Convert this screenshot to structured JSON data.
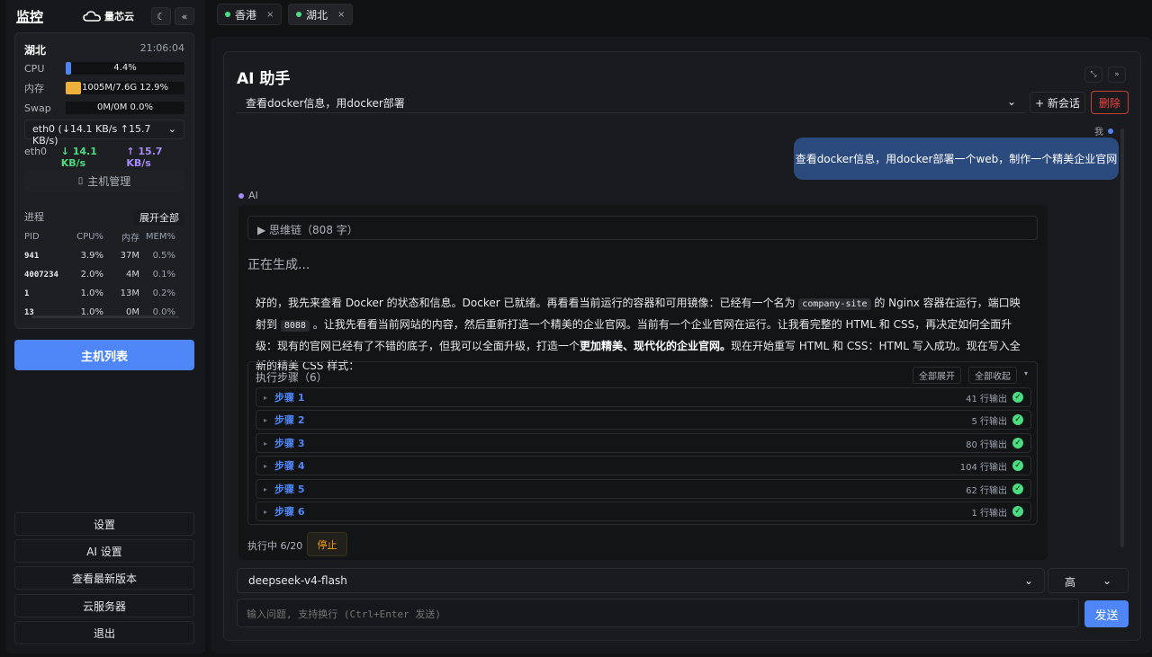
{
  "sidebar": {
    "title": "监控",
    "logo_text": "量芯云",
    "theme_icon": "moon-icon",
    "collapse_label": "«",
    "host": {
      "name": "湖北",
      "time": "21:06:04",
      "cpu": {
        "label": "CPU",
        "text": "4.4%",
        "percent": 4.4,
        "color": "#4f86f7"
      },
      "mem": {
        "label": "内存",
        "text": "1005M/7.6G 12.9%",
        "percent": 12.9,
        "color": "#f0b13b"
      },
      "swap": {
        "label": "Swap",
        "text": "0M/0M 0.0%",
        "percent": 0
      },
      "net_select": "eth0 (↓14.1 KB/s ↑15.7 KB/s)",
      "net_iface": "eth0",
      "net_down": "↓ 14.1 KB/s",
      "net_up": "↑ 15.7 KB/s",
      "host_mgmt": "主机管理",
      "process_label": "进程",
      "expand_all": "展开全部",
      "proc_headers": [
        "PID",
        "CPU%",
        "内存",
        "MEM%"
      ],
      "processes": [
        {
          "pid": "941",
          "cpu": "3.9%",
          "mem": "37M",
          "memp": "0.5%"
        },
        {
          "pid": "4007234",
          "cpu": "2.0%",
          "mem": "4M",
          "memp": "0.1%"
        },
        {
          "pid": "1",
          "cpu": "1.0%",
          "mem": "13M",
          "memp": "0.2%"
        },
        {
          "pid": "13",
          "cpu": "1.0%",
          "mem": "0M",
          "memp": "0.0%"
        }
      ]
    },
    "host_list": "主机列表",
    "bottom": [
      "设置",
      "AI 设置",
      "查看最新版本",
      "云服务器",
      "退出"
    ]
  },
  "tabs": [
    {
      "label": "香港",
      "close": "×"
    },
    {
      "label": "湖北",
      "close": "×"
    }
  ],
  "main": {
    "title": "AI 助手",
    "session": "查看docker信息，用docker部署",
    "new_session": "+ 新会话",
    "delete": "删除",
    "me_label": "我",
    "user_msg": "查看docker信息，用docker部署一个web，制作一个精美企业官网",
    "ai_label": "AI",
    "think": "▶ 思维链（808 字）",
    "generating": "正在生成...",
    "reply": {
      "p1": "好的，我先来查看 Docker 的状态和信息。Docker 已就绪。再看看当前运行的容器和可用镜像：已经有一个名为 ",
      "code1": "company-site",
      "p2": " 的 Nginx 容器在运行，端口映射到 ",
      "code2": "8088",
      "p3": " 。让我先看看当前网站的内容，然后重新打造一个精美的企业官网。当前有一个企业官网在运行。让我看完整的 HTML 和 CSS，再决定如何全面升级：现有的官网已经有了不错的底子，但我可以全面升级，打造一个",
      "bold": "更加精美、现代化的企业官网。",
      "p4": "现在开始重写 HTML 和 CSS：HTML 写入成功。现在写入全新的精美 CSS 样式："
    },
    "steps_title": "执行步骤（6）",
    "expand_all": "全部展开",
    "collapse_all": "全部收起",
    "steps": [
      {
        "name": "步骤 1",
        "out": "41 行输出"
      },
      {
        "name": "步骤 2",
        "out": "5 行输出"
      },
      {
        "name": "步骤 3",
        "out": "80 行输出"
      },
      {
        "name": "步骤 4",
        "out": "104 行输出"
      },
      {
        "name": "步骤 5",
        "out": "62 行输出"
      },
      {
        "name": "步骤 6",
        "out": "1 行输出"
      }
    ],
    "running": "执行中 6/20",
    "stop": "停止",
    "model": "deepseek-v4-flash",
    "level": "高",
    "input_placeholder": "输入问题, 支持换行 (Ctrl+Enter 发送)",
    "send": "发送"
  }
}
